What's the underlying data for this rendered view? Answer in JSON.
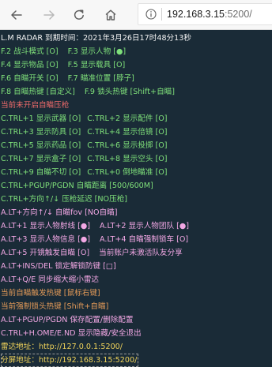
{
  "browser": {
    "address_host": "192.168.3.15",
    "address_path": ":5200/"
  },
  "colors": {
    "background": "#1a2b37",
    "green": "#7fe07a",
    "red": "#f06b6b",
    "pink": "#f2a7e4",
    "orange": "#e39a58",
    "yellow": "#f0d35a",
    "white": "#f2f2f2"
  },
  "icons": {
    "back": "arrow-left-icon",
    "forward": "arrow-right-icon",
    "refresh": "refresh-icon",
    "home": "home-icon",
    "info": "info-circle-icon"
  },
  "menu": {
    "title": "L.M RADAR 到期时间：2021年3月26日17时48分13秒",
    "f2": "F.2 战斗模式 [O]",
    "f3": "F.3 显示人物 [●]",
    "f4": "F.4 显示物品 [O]",
    "f5": "F.5 显示载具 [O]",
    "f6": "F.6 自瞄开关 [O]",
    "f7": "F.7 瞄准位置 [脖子]",
    "f8": "F.8 自瞄热键 [自定义]",
    "f9": "F.9 锁头热键 [Shift+自瞄]",
    "no_aim": "当前未开启自瞄压枪",
    "ctrl1": "C.TRL+1 显示武器 [O]",
    "ctrl2": "C.TRL+2 显示配件 [O]",
    "ctrl3": "C.TRL+3 显示防具 [O]",
    "ctrl4": "C.TRL+4 显示倍镜 [O]",
    "ctrl5": "C.TRL+5 显示药品 [O]",
    "ctrl6": "C.TRL+6 显示投掷 [O]",
    "ctrl7": "C.TRL+7 显示盒子 [O]",
    "ctrl8": "C.TRL+8 显示空头 [O]",
    "ctrl9": "C.TRL+9 自瞄不切 [O]",
    "ctrl0": "C.TRL+0 倒地瞄准 [O]",
    "ctrl_pgup": "C.TRL+PGUP/PGDN 自瞄距离 [500/600M]",
    "ctrl_arrow": "C.TRL+方向↑/↓ 压枪延迟 [NO压枪]",
    "alt_arrow": "A.LT+方向↑/↓ 自瞄fov [NO自瞄]",
    "alt1": "A.LT+1 显示人物射线 [●]",
    "alt2": "A.LT+2 显示人物团队 [●]",
    "alt3": "A.LT+3 显示人物信息 [●]",
    "alt4": "A.LT+4 自瞄强制锁车 [O]",
    "alt5": "A.LT+5 开镜触发自瞄 [O]",
    "alt5_note": "当前账户未激活队友分享",
    "alt_ins": "A.LT+INS/DEL 锁定解锁防键 [□]",
    "alt_q": "A.LT+Q/E 同步缩大缩小雷达",
    "trigger": "当前自瞄触发热键 [鼠标右键]",
    "lock": "当前强制锁头热键 [Shift+自瞄]",
    "alt_pgup": "A.LT+PGUP/PGDN 保存配置/删除配置",
    "ctrl_home": "C.TRL+H.OME/E.ND 显示隐藏/安全退出",
    "radar_addr": "雷达地址：http://127.0.0.1:5200/",
    "share_addr": "分屏地址：http://192.168.3.15:5200/"
  }
}
